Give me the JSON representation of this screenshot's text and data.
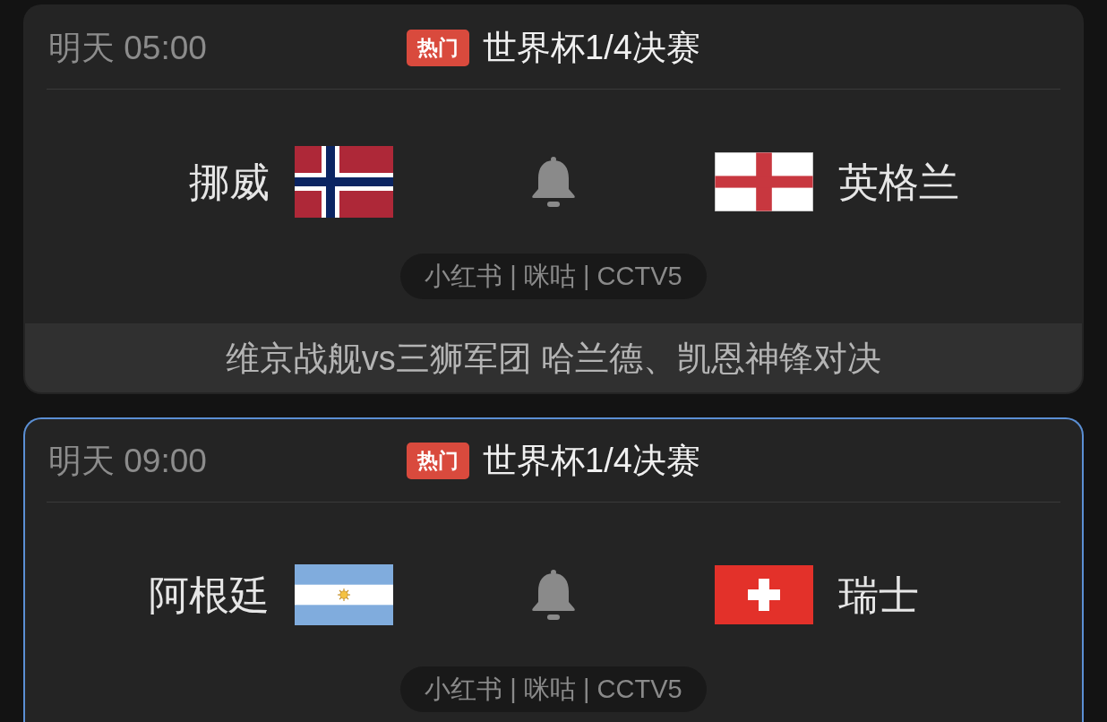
{
  "matches": [
    {
      "selected": false,
      "time": "明天 05:00",
      "badge": "热门",
      "competition": "世界杯1/4决赛",
      "teams": [
        {
          "name": "挪威",
          "kind": "norway"
        },
        {
          "name": "英格兰",
          "kind": "england"
        }
      ],
      "channels": "小红书 | 咪咕 | CCTV5",
      "caption": "维京战舰vs三狮军团 哈兰德、凯恩神锋对决"
    },
    {
      "selected": true,
      "time": "明天 09:00",
      "badge": "热门",
      "competition": "世界杯1/4决赛",
      "teams": [
        {
          "name": "阿根廷",
          "kind": "argentina"
        },
        {
          "name": "瑞士",
          "kind": "switzerland"
        }
      ],
      "channels": "小红书 | 咪咕 | CCTV5"
    }
  ]
}
